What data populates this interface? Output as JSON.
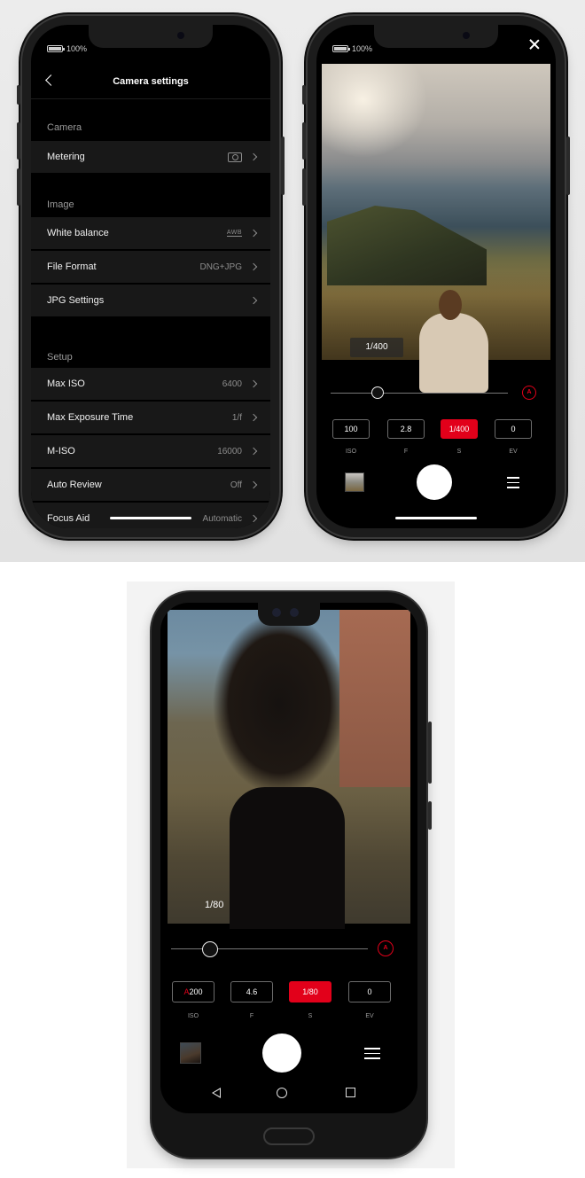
{
  "settings_phone": {
    "status": {
      "battery_text": "100%"
    },
    "header": {
      "title": "Camera settings"
    },
    "sections": [
      {
        "label": "Camera",
        "rows": [
          {
            "label": "Metering",
            "value": "",
            "icon": "spot-metering-icon"
          }
        ]
      },
      {
        "label": "Image",
        "rows": [
          {
            "label": "White balance",
            "value": "AWB",
            "icon": "awb-icon"
          },
          {
            "label": "File Format",
            "value": "DNG+JPG"
          },
          {
            "label": "JPG Settings",
            "value": ""
          }
        ]
      },
      {
        "label": "Setup",
        "rows": [
          {
            "label": "Max ISO",
            "value": "6400"
          },
          {
            "label": "Max Exposure Time",
            "value": "1/f"
          },
          {
            "label": "M-ISO",
            "value": "16000"
          },
          {
            "label": "Auto Review",
            "value": "Off"
          },
          {
            "label": "Focus Aid",
            "value": "Automatic"
          }
        ]
      }
    ]
  },
  "camera_phone": {
    "status": {
      "battery_text": "100%"
    },
    "exposure_readout": "1/400",
    "auto_label": "A",
    "params": [
      {
        "value": "100",
        "label": "ISO",
        "active": false
      },
      {
        "value": "2.8",
        "label": "F",
        "active": false
      },
      {
        "value": "1/400",
        "label": "S",
        "active": true
      },
      {
        "value": "0",
        "label": "EV",
        "active": false
      }
    ]
  },
  "android_phone": {
    "exposure_readout": "1/80",
    "auto_label": "A",
    "params": [
      {
        "value": "200",
        "prefix": "A",
        "label": "ISO",
        "active": false
      },
      {
        "value": "4.6",
        "label": "F",
        "active": false
      },
      {
        "value": "1/80",
        "label": "S",
        "active": true
      },
      {
        "value": "0",
        "label": "EV",
        "active": false
      }
    ]
  },
  "colors": {
    "accent_red": "#e2001a",
    "row_bg": "#181818",
    "screen_bg": "#000000"
  }
}
